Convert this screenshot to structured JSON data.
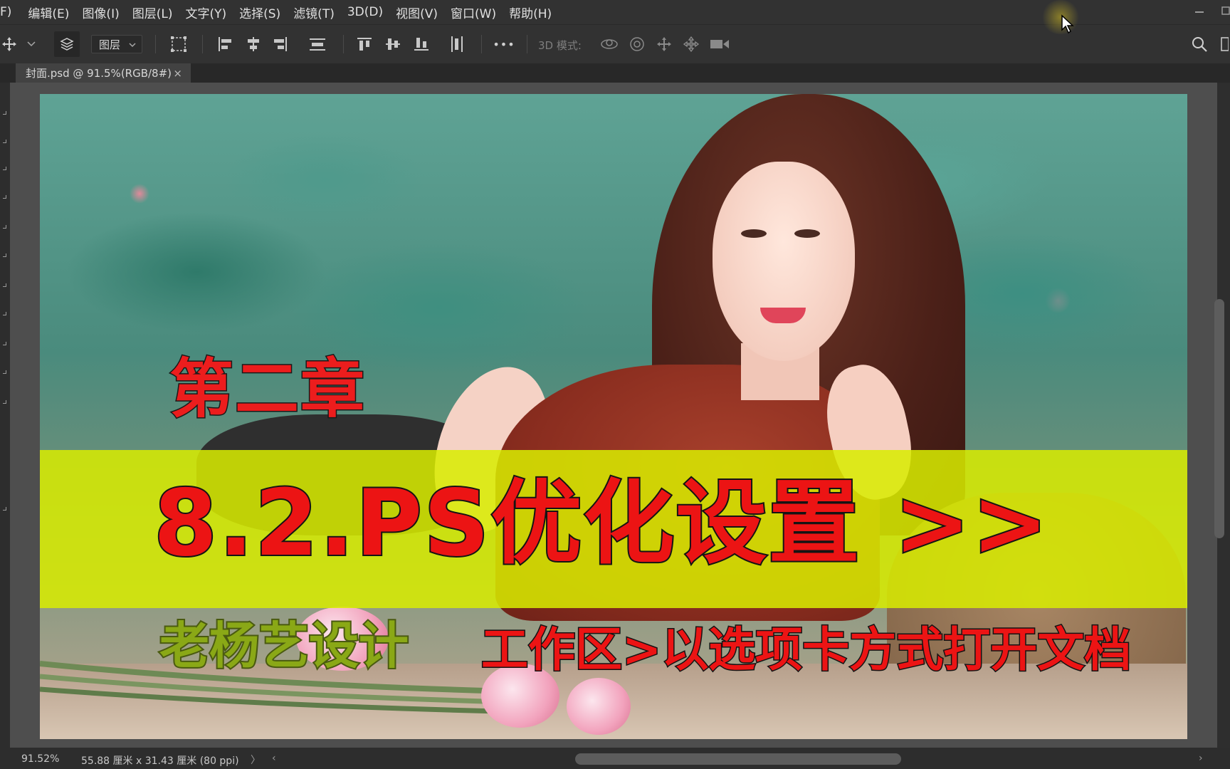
{
  "menu": {
    "items": [
      "F)",
      "编辑(E)",
      "图像(I)",
      "图层(L)",
      "文字(Y)",
      "选择(S)",
      "滤镜(T)",
      "3D(D)",
      "视图(V)",
      "窗口(W)",
      "帮助(H)"
    ]
  },
  "options_bar": {
    "layer_select": "图层",
    "mode_3d_label": "3D 模式:",
    "more_label": "•••"
  },
  "tab": {
    "title": "封面.psd @ 91.5%(RGB/8#)",
    "close": "×"
  },
  "canvas_text": {
    "chapter": "第二章",
    "headline": "8.2.PS优化设置 >>",
    "author": "老杨艺设计",
    "subtitle": "工作区>以选项卡方式打开文档"
  },
  "status": {
    "zoom": "91.52%",
    "doc_size": "55.88 厘米 x 31.43 厘米 (80 ppi)",
    "arrow_right": "〉",
    "arrow_left": "‹",
    "arrow_end": "›"
  },
  "colors": {
    "ui_dark": "#323232",
    "accent_yellow": "#d9ec00",
    "text_red": "#ec1414"
  }
}
